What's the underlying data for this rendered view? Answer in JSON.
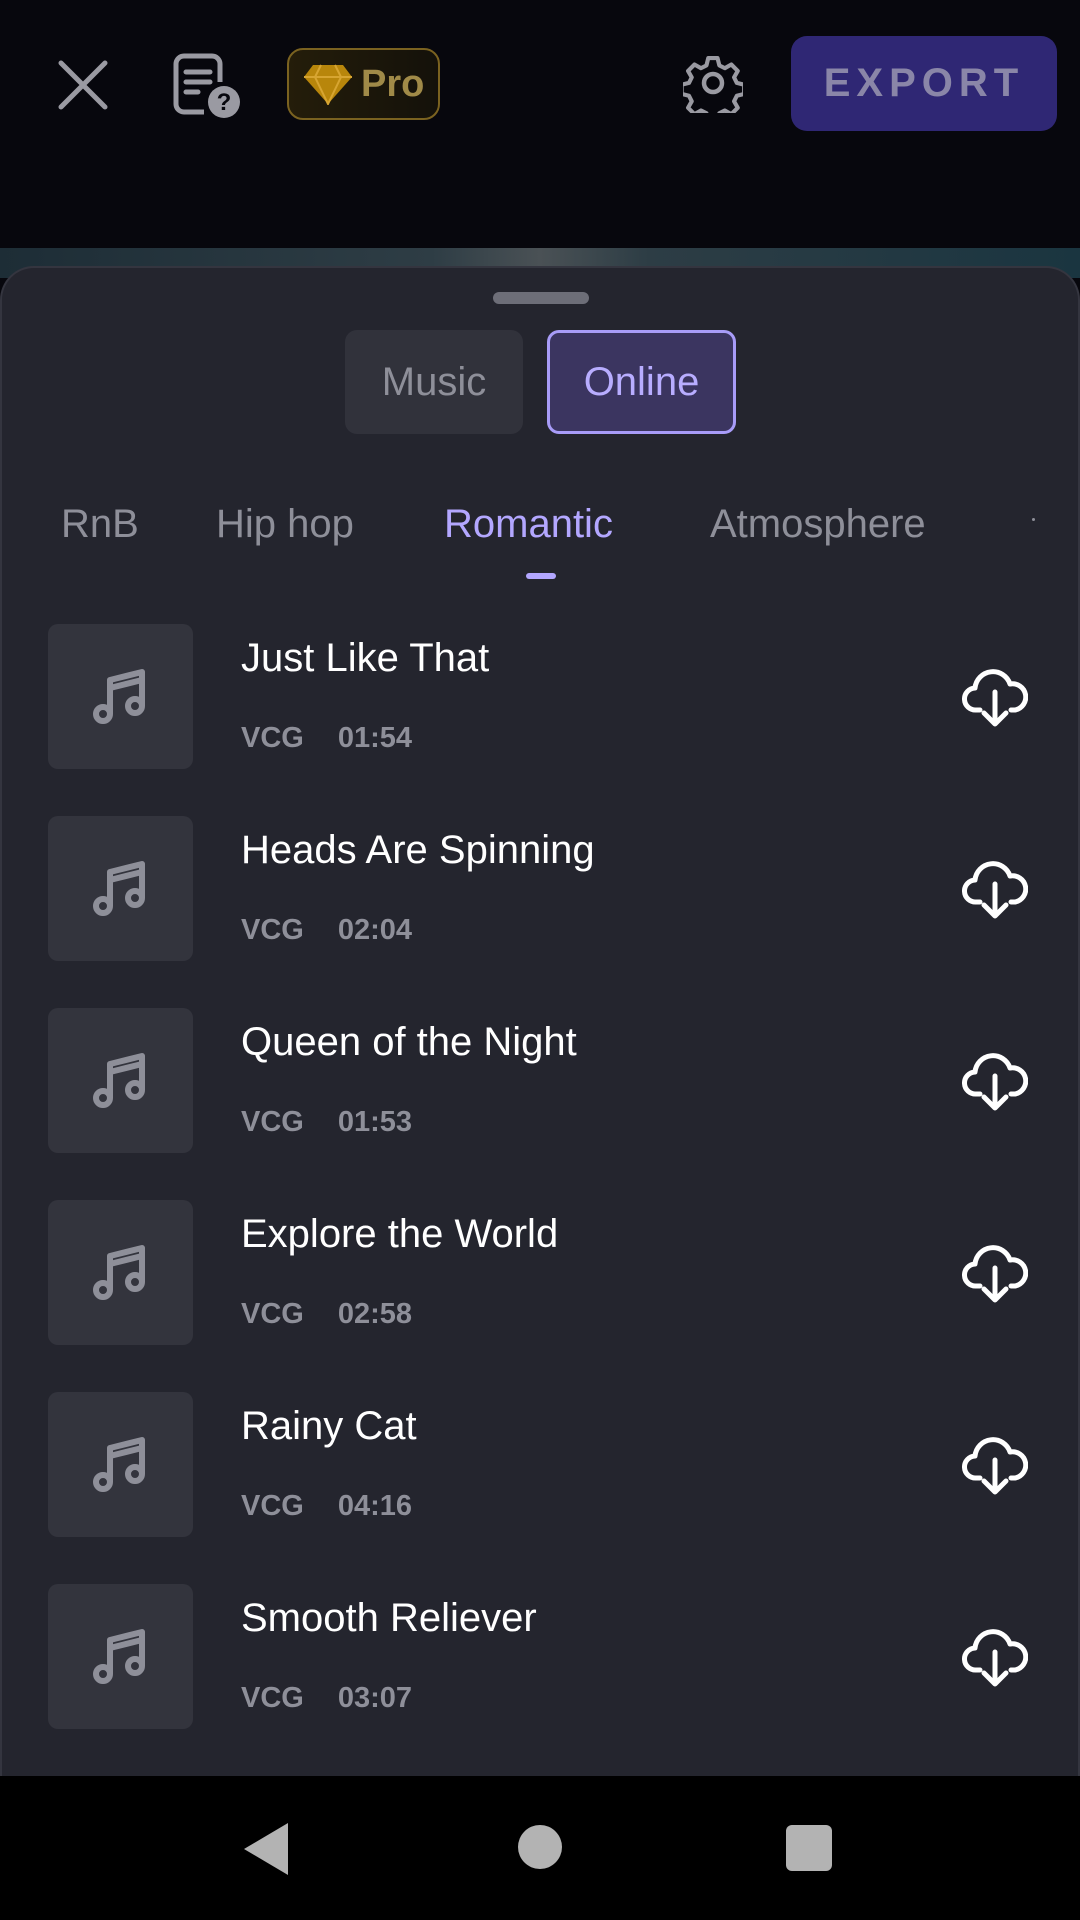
{
  "toolbar": {
    "pro_label": "Pro",
    "export_label": "EXPORT"
  },
  "segments": {
    "music_label": "Music",
    "online_label": "Online",
    "selected": "Online"
  },
  "categories": [
    {
      "label": "RnB"
    },
    {
      "label": "Hip hop"
    },
    {
      "label": "Romantic"
    },
    {
      "label": "Atmosphere"
    }
  ],
  "active_category": "Romantic",
  "tracks": [
    {
      "title": "Just Like That",
      "artist": "VCG",
      "duration": "01:54"
    },
    {
      "title": "Heads Are Spinning",
      "artist": "VCG",
      "duration": "02:04"
    },
    {
      "title": "Queen of the Night",
      "artist": "VCG",
      "duration": "01:53"
    },
    {
      "title": "Explore the World",
      "artist": "VCG",
      "duration": "02:58"
    },
    {
      "title": "Rainy Cat",
      "artist": "VCG",
      "duration": "04:16"
    },
    {
      "title": "Smooth Reliever",
      "artist": "VCG",
      "duration": "03:07"
    }
  ],
  "icons": {
    "close": "close-icon",
    "help": "document-help-icon",
    "pro": "diamond-icon",
    "settings": "gear-icon",
    "track": "music-note-icon",
    "download": "cloud-download-icon"
  },
  "colors": {
    "accent": "#b3a7ff",
    "export_bg": "#2f2774",
    "sheet_bg": "#24252e",
    "pro_gold": "#a08a48"
  }
}
